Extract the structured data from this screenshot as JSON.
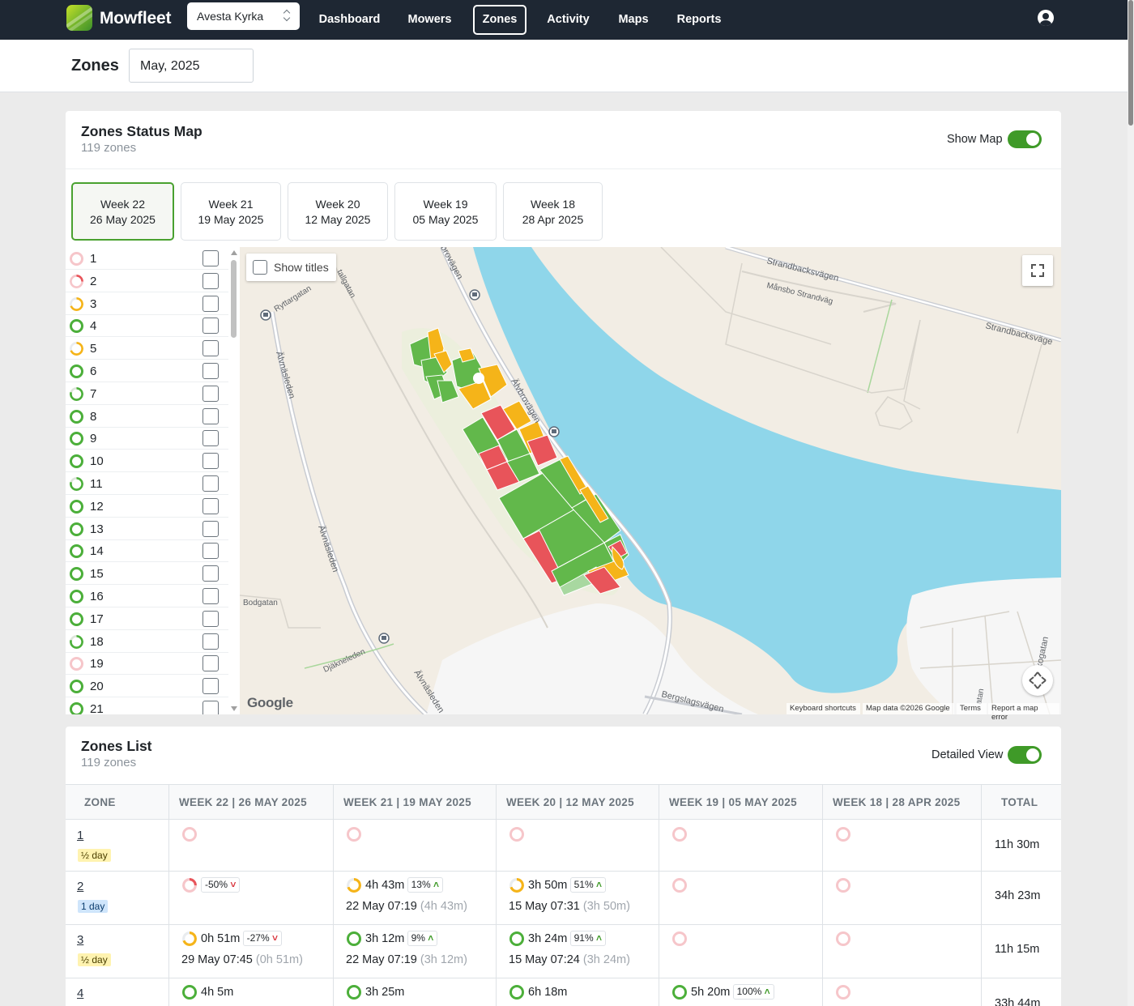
{
  "app": {
    "brand": "Mowfleet",
    "site": "Avesta Kyrka",
    "nav": [
      "Dashboard",
      "Mowers",
      "Zones",
      "Activity",
      "Maps",
      "Reports"
    ],
    "active_nav": "Zones"
  },
  "page": {
    "title": "Zones",
    "month": "May, 2025"
  },
  "status_map": {
    "title": "Zones Status Map",
    "subtitle": "119 zones",
    "toggle_label": "Show Map",
    "toggle_on": true,
    "weeks": [
      {
        "week": "Week 22",
        "date": "26 May 2025",
        "active": true
      },
      {
        "week": "Week 21",
        "date": "19 May 2025",
        "active": false
      },
      {
        "week": "Week 20",
        "date": "12 May 2025",
        "active": false
      },
      {
        "week": "Week 19",
        "date": "05 May 2025",
        "active": false
      },
      {
        "week": "Week 18",
        "date": "28 Apr 2025",
        "active": false
      }
    ],
    "zones": [
      {
        "name": "1",
        "status": "none"
      },
      {
        "name": "2",
        "status": "low"
      },
      {
        "name": "3",
        "status": "partial"
      },
      {
        "name": "4",
        "status": "full"
      },
      {
        "name": "5",
        "status": "partial"
      },
      {
        "name": "6",
        "status": "full"
      },
      {
        "name": "7",
        "status": "mostly"
      },
      {
        "name": "8",
        "status": "full"
      },
      {
        "name": "9",
        "status": "full"
      },
      {
        "name": "10",
        "status": "full"
      },
      {
        "name": "11",
        "status": "mostly"
      },
      {
        "name": "12",
        "status": "full"
      },
      {
        "name": "13",
        "status": "full"
      },
      {
        "name": "14",
        "status": "full"
      },
      {
        "name": "15",
        "status": "full"
      },
      {
        "name": "16",
        "status": "full"
      },
      {
        "name": "17",
        "status": "full"
      },
      {
        "name": "18",
        "status": "mostly"
      },
      {
        "name": "19",
        "status": "none"
      },
      {
        "name": "20",
        "status": "full"
      },
      {
        "name": "21",
        "status": "full"
      }
    ],
    "map": {
      "show_titles": "Show titles",
      "labels": {
        "strandbacksvagen1": "Strandbacksvägen",
        "mansbo": "Månsbo Strandväg",
        "strandbacksvagen2": "Strandbacksväge",
        "ryttargatan": "Ryttargatan",
        "alvnasleden1": "Älvnäsleden",
        "alvnasleden2": "Älvnäsleden",
        "alvnasleden3": "Älvnäsleden",
        "alvbrovagen": "Älvbrovägen",
        "brovagen": "brovägen",
        "tall": "tallgatan",
        "bodgatan": "Bodgatan",
        "djakneleden": "Djäkneleden",
        "bergslagsvagen": "Bergslagsvägen",
        "kogatan": "kogatan",
        "atan": "atan"
      },
      "google": "Google",
      "footer": [
        "Keyboard shortcuts",
        "Map data ©2026 Google",
        "Terms",
        "Report a map error"
      ]
    }
  },
  "zones_list": {
    "title": "Zones List",
    "subtitle": "119 zones",
    "toggle_label": "Detailed View",
    "toggle_on": true,
    "columns": [
      "ZONE",
      "WEEK 22 | 26 MAY 2025",
      "WEEK 21 | 19 MAY 2025",
      "WEEK 20 | 12 MAY 2025",
      "WEEK 19 | 05 MAY 2025",
      "WEEK 18 | 28 APR 2025",
      "TOTAL"
    ],
    "rows": [
      {
        "zone": "1",
        "badge": "½ day",
        "badge_type": "half",
        "cells": [
          {
            "status": "none"
          },
          {
            "status": "none"
          },
          {
            "status": "none"
          },
          {
            "status": "none"
          },
          {
            "status": "none"
          }
        ],
        "total": "11h 30m"
      },
      {
        "zone": "2",
        "badge": "1 day",
        "badge_type": "one",
        "cells": [
          {
            "status": "low",
            "pct": "-50%",
            "trend": "down"
          },
          {
            "status": "partial",
            "duration": "4h 43m",
            "pct": "13%",
            "trend": "up",
            "when": "22 May 07:19",
            "when_detail": "(4h 43m)"
          },
          {
            "status": "partial",
            "duration": "3h 50m",
            "pct": "51%",
            "trend": "up",
            "when": "15 May 07:31",
            "when_detail": "(3h 50m)"
          },
          {
            "status": "none"
          },
          {
            "status": "none"
          }
        ],
        "total": "34h 23m"
      },
      {
        "zone": "3",
        "badge": "½ day",
        "badge_type": "half",
        "cells": [
          {
            "status": "partial",
            "duration": "0h 51m",
            "pct": "-27%",
            "trend": "down",
            "when": "29 May 07:45",
            "when_detail": "(0h 51m)"
          },
          {
            "status": "full",
            "duration": "3h 12m",
            "pct": "9%",
            "trend": "up",
            "when": "22 May 07:19",
            "when_detail": "(3h 12m)"
          },
          {
            "status": "full",
            "duration": "3h 24m",
            "pct": "91%",
            "trend": "up",
            "when": "15 May 07:24",
            "when_detail": "(3h 24m)"
          },
          {
            "status": "none"
          },
          {
            "status": "none"
          }
        ],
        "total": "11h 15m"
      },
      {
        "zone": "4",
        "badge": "",
        "badge_type": "",
        "cells": [
          {
            "status": "full",
            "duration": "4h 5m"
          },
          {
            "status": "full",
            "duration": "3h 25m"
          },
          {
            "status": "full",
            "duration": "6h 18m"
          },
          {
            "status": "full",
            "duration": "5h 20m",
            "pct": "100%",
            "trend": "up"
          },
          {
            "status": "none"
          }
        ],
        "total": "33h 44m"
      }
    ]
  },
  "colors": {
    "nav_bg": "#1e2733",
    "accent_green": "#3f9a28",
    "status_full": "#4caf3a",
    "status_partial": "#f5b419",
    "status_low": "#e8545a",
    "status_none": "#f6c6ca",
    "water": "#8fd6ea"
  }
}
